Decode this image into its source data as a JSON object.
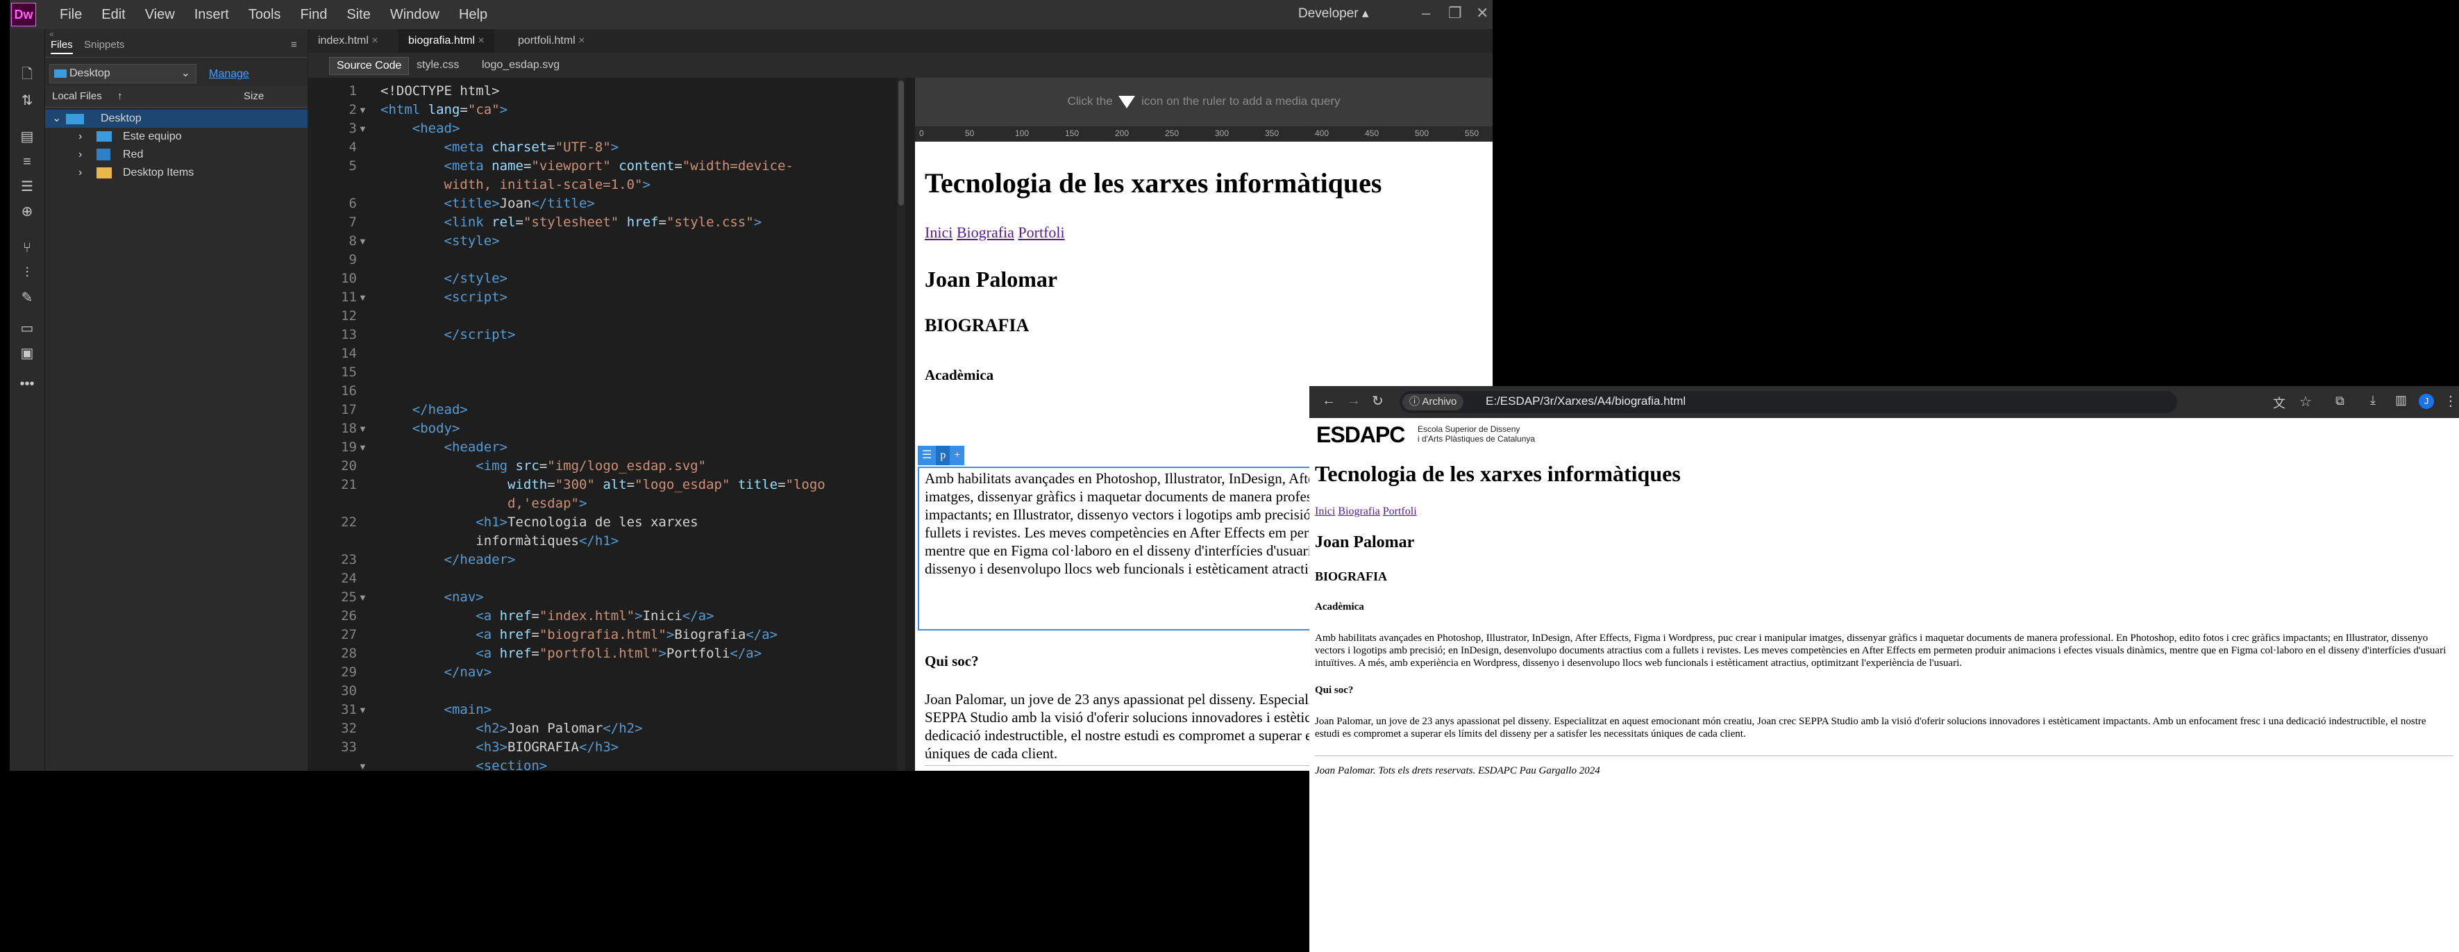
{
  "dreamweaver": {
    "logo": "Dw",
    "menu": [
      "File",
      "Edit",
      "View",
      "Insert",
      "Tools",
      "Find",
      "Site",
      "Window",
      "Help"
    ],
    "workspace": "Developer",
    "panel_tabs": [
      "Files",
      "Snippets"
    ],
    "files_location": "Desktop",
    "manage": "Manage",
    "col_local": "Local Files",
    "col_size": "Size",
    "tree": [
      "Desktop",
      "Este equipo",
      "Red",
      "Desktop Items"
    ],
    "doc_tabs": [
      "index.html",
      "biografia.html",
      "portfoli.html"
    ],
    "sub_tabs": [
      "Source Code",
      "style.css",
      "logo_esdap.svg"
    ],
    "code_lines": [
      [
        "1",
        ""
      ],
      [
        "2",
        "▼"
      ],
      [
        "3",
        "▼"
      ],
      [
        "4",
        ""
      ],
      [
        "5",
        ""
      ],
      [
        "",
        ""
      ],
      [
        "6",
        ""
      ],
      [
        "7",
        ""
      ],
      [
        "8",
        "▼"
      ],
      [
        "9",
        ""
      ],
      [
        "10",
        ""
      ],
      [
        "11",
        "▼"
      ],
      [
        "12",
        ""
      ],
      [
        "13",
        ""
      ],
      [
        "14",
        ""
      ],
      [
        "15",
        ""
      ],
      [
        "16",
        ""
      ],
      [
        "17",
        ""
      ],
      [
        "18",
        "▼"
      ],
      [
        "19",
        "▼"
      ],
      [
        "20",
        ""
      ],
      [
        "21",
        ""
      ],
      [
        "",
        ""
      ],
      [
        "22",
        ""
      ],
      [
        "",
        ""
      ],
      [
        "23",
        ""
      ],
      [
        "24",
        ""
      ],
      [
        "25",
        "▼"
      ],
      [
        "26",
        ""
      ],
      [
        "27",
        ""
      ],
      [
        "28",
        ""
      ],
      [
        "29",
        ""
      ],
      [
        "30",
        ""
      ],
      [
        "31",
        "▼"
      ],
      [
        "32",
        ""
      ],
      [
        "33",
        ""
      ],
      [
        "",
        "▼"
      ]
    ],
    "mq_hint_before": "Click the",
    "mq_hint_after": "icon on the ruler to add a media query",
    "ruler": [
      "0",
      "50",
      "100",
      "150",
      "200",
      "250",
      "300",
      "350",
      "400",
      "450",
      "500",
      "550"
    ],
    "selected_tag": "p"
  },
  "site": {
    "h1": "Tecnologia de les xarxes informàtiques",
    "nav": [
      "Inici",
      "Biografia",
      "Portfoli"
    ],
    "h2": "Joan Palomar",
    "h3": "BIOGRAFIA",
    "h4_academica": "Acadèmica",
    "p_academica": "Amb habilitats avançades en Photoshop, Illustrator, InDesign, After Effects, Figma i Wordpress, puc crear i manipular imatges, dissenyar gràfics i maquetar documents de manera professional. En Photoshop, edito fotos i crec gràfics impactants; en Illustrator, dissenyo vectors i logotips amb precisió; en InDesign, desenvolupo documents atractius com a fullets i revistes. Les meves competències en After Effects em permeten produir animacions i efectes visuals dinàmics, mentre que en Figma col·laboro en el disseny d'interfícies d'usuari intuïtives. A més, amb experiència en Wordpress, dissenyo i desenvolupo llocs web funcionals i estèticament atractius, optimitzant l'experiència de l'usuari.",
    "h4_quisoc": "Qui soc?",
    "p_quisoc": "Joan Palomar, un jove de 23 anys apassionat pel disseny. Especialitzat en aquest emocionant món creatiu, Joan crec SEPPA Studio amb la visió d'oferir solucions innovadores i estèticament impactants. Amb un enfocament fresc i una dedicació indestructible, el nostre estudi es compromet a superar els límits del disseny per a satisfer les necessitats úniques de cada client.",
    "footer": "Joan Palomar. Tots els drets reservats. ESDAPC Pau Gargallo 2024"
  },
  "chrome": {
    "badge": "Archivo",
    "url": "E:/ESDAP/3r/Xarxes/A4/biografia.html",
    "profile": "J",
    "logo_text": "ESDAPC",
    "logo_sub1": "Escola Superior de Disseny",
    "logo_sub2": "i d'Arts Plàstiques de Catalunya"
  }
}
